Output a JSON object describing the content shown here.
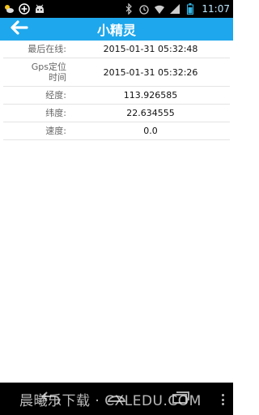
{
  "status_bar": {
    "time": "11:07",
    "left_icons": [
      "weather-icon",
      "add-icon",
      "android-icon"
    ],
    "right_icons": [
      "bluetooth-icon",
      "alarm-icon",
      "wifi-icon",
      "signal-icon",
      "battery-icon"
    ]
  },
  "header": {
    "title": "小精灵",
    "background": "#1ea7ec"
  },
  "info": {
    "rows": [
      {
        "label": "最后在线:",
        "value": "2015-01-31 05:32:48"
      },
      {
        "label": "Gps定位时间",
        "value": "2015-01-31 05:32:26"
      },
      {
        "label": "经度:",
        "value": "113.926585"
      },
      {
        "label": "纬度:",
        "value": "22.634555"
      },
      {
        "label": "速度:",
        "value": "0.0"
      }
    ]
  },
  "watermark": {
    "text": "晨曦乐下载 · CXLEDU.COM"
  }
}
